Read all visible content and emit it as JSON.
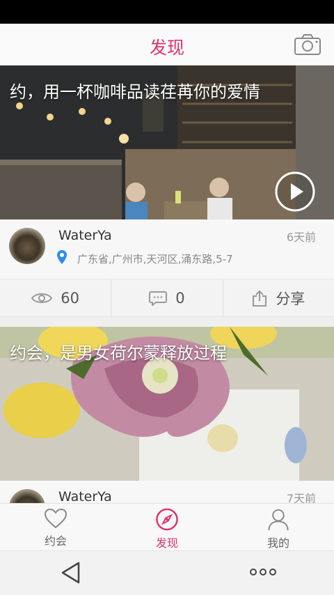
{
  "header": {
    "title": "发现",
    "camera_icon": "camera-icon"
  },
  "posts": [
    {
      "caption": "约，用一杯咖啡品读荏苒你的爱情",
      "author": "WaterYa",
      "time": "6天前",
      "location": "广东省,广州市,天河区,涌东路,5-7",
      "views": "60",
      "comments": "0",
      "share_label": "分享",
      "has_video": true
    },
    {
      "caption": "约会，是男女荷尔蒙释放过程",
      "author": "WaterYa",
      "time": "7天前"
    }
  ],
  "tabs": [
    {
      "label": "约会",
      "icon": "heart-icon",
      "active": false
    },
    {
      "label": "发现",
      "icon": "compass-icon",
      "active": true
    },
    {
      "label": "我的",
      "icon": "person-icon",
      "active": false
    }
  ],
  "colors": {
    "accent": "#e0306d",
    "pin": "#2d8cf0"
  }
}
